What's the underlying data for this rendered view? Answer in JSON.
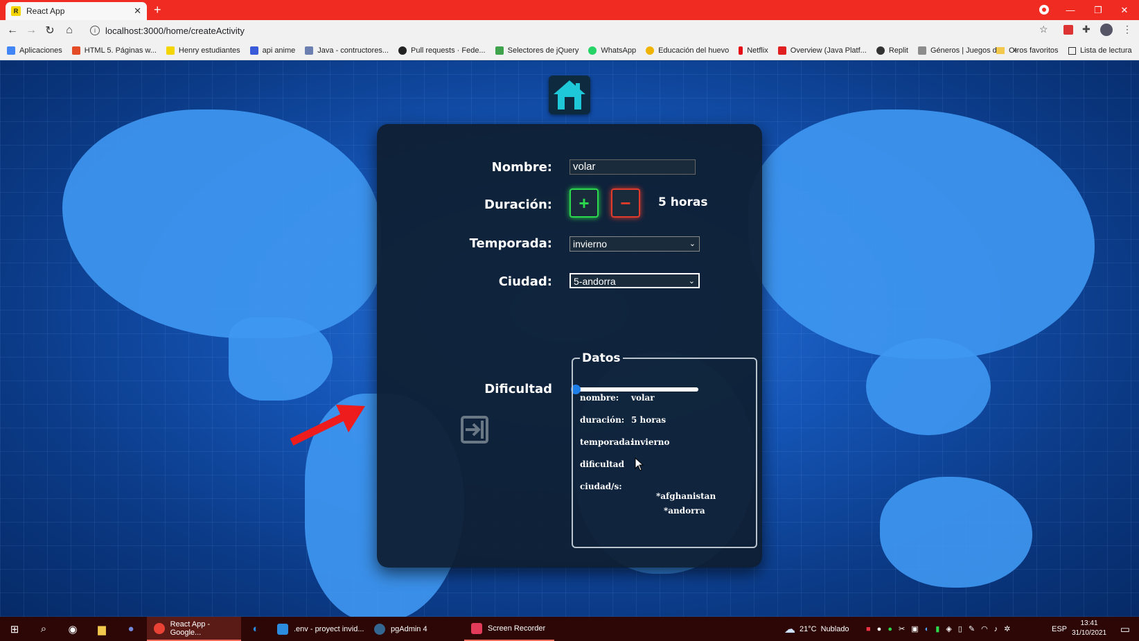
{
  "browser": {
    "tab_title": "React App",
    "tab_favicon": "react-favicon",
    "url": "localhost:3000/home/createActivity",
    "tab_bar_color": "#ef2b22"
  },
  "bookmarks": [
    {
      "label": "Aplicaciones",
      "color": "#4285f4"
    },
    {
      "label": "HTML 5. Páginas w...",
      "color": "#e34c26"
    },
    {
      "label": "Henry estudiantes",
      "color": "#f5d500"
    },
    {
      "label": "api anime",
      "color": "#3a5bd9"
    },
    {
      "label": "Java - contructores...",
      "color": "#6b7fb0"
    },
    {
      "label": "Pull requests · Fede...",
      "color": "#222222"
    },
    {
      "label": "Selectores de jQuery",
      "color": "#3fa34d"
    },
    {
      "label": "WhatsApp",
      "color": "#25d366"
    },
    {
      "label": "Educación del huevo",
      "color": "#f0b400"
    },
    {
      "label": "Netflix",
      "color": "#e50914"
    },
    {
      "label": "Overview (Java Platf...",
      "color": "#e02020"
    },
    {
      "label": "Replit",
      "color": "#333333"
    },
    {
      "label": "Géneros | Juegos d...",
      "color": "#8c8c8c"
    }
  ],
  "bookmarks_more": "»",
  "bookmarks_right": {
    "otros": "Otros favoritos",
    "lectura": "Lista de lectura"
  },
  "form": {
    "nombre_label": "Nombre:",
    "nombre_value": "volar",
    "duracion_label": "Duración:",
    "plus_symbol": "+",
    "minus_symbol": "−",
    "duracion_value": "5 horas",
    "temporada_label": "Temporada:",
    "temporada_value": "invierno",
    "ciudad_label": "Ciudad:",
    "ciudad_value": "5-andorra",
    "dificultad_label": "Dificultad",
    "dificultad_level": 0
  },
  "datos": {
    "legend": "Datos",
    "nombre_label": "nombre:",
    "nombre_value": "volar",
    "duracion_label": "duración:",
    "duracion_value": "5 horas",
    "temporada_label": "temporada:",
    "temporada_value": "invierno",
    "dificultad_label": "dificultad",
    "ciudades_label": "ciudad/s:",
    "ciudades": [
      "*afghanistan",
      "*andorra"
    ]
  },
  "taskbar": {
    "apps": [
      {
        "label": "React App - Google...",
        "color": "#ea4335",
        "active": true
      },
      {
        "label": ".env - proyect invid...",
        "color": "#2c8ce0",
        "active": false
      },
      {
        "label": "pgAdmin 4",
        "color": "#336791",
        "active": false
      },
      {
        "label": "Screen Recorder",
        "color": "#e23b5a",
        "active": false
      }
    ],
    "weather_temp": "21°C",
    "weather_text": "Nublado",
    "language": "ESP",
    "time": "13:41",
    "date": "31/10/2021"
  }
}
